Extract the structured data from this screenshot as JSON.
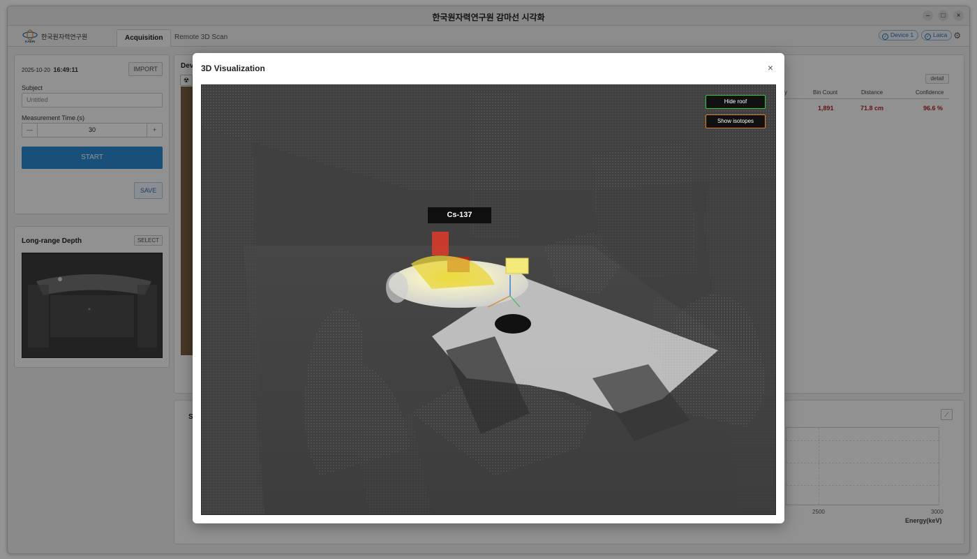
{
  "window": {
    "title": "한국원자력연구원 감마선 시각화"
  },
  "appbar": {
    "logo_text": "한국원자력연구원",
    "logo_mark_text": "KAERI",
    "tabs": [
      {
        "label": "Acquisition",
        "active": true
      },
      {
        "label": "Remote 3D Scan",
        "active": false
      }
    ],
    "devices": [
      "Device 1",
      "Laica"
    ]
  },
  "acquisition": {
    "date": "2025-10-20",
    "time": "16:49:11",
    "import_label": "IMPORT",
    "subject_label": "Subject",
    "subject_placeholder": "Untitled",
    "measurement_label": "Measurement Time.(s)",
    "measurement_value": "30",
    "minus": "—",
    "plus": "+",
    "start_label": "START",
    "save_label": "SAVE"
  },
  "depth": {
    "title": "Long-range Depth",
    "select_label": "SELECT"
  },
  "background_panels": {
    "device_label": "Devi",
    "detail_label": "detail",
    "table_headers": [
      "y",
      "Bin Count",
      "Distance",
      "Confidence"
    ],
    "row": {
      "bin_count": "1,891",
      "distance": "71.8 cm",
      "confidence": "96.6 %"
    },
    "spectrum_label": "Sp",
    "x_ticks": [
      "2500",
      "3000"
    ],
    "x_axis_label": "Energy(keV)"
  },
  "modal": {
    "title": "3D Visualization",
    "close": "×",
    "hide_roof_label": "Hide roof",
    "show_isotopes_label": "Show isotopes",
    "isotope_label": "Cs-137"
  },
  "colors": {
    "accent": "#2a8bd1",
    "hide_roof_border": "#2ecc40",
    "show_isotopes_border": "#e67e22",
    "highlight_red": "#b22222"
  }
}
